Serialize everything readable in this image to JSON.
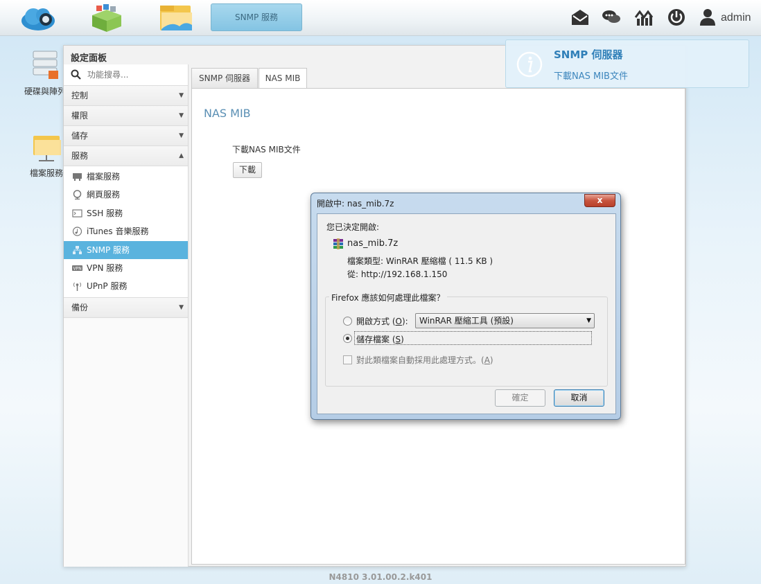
{
  "topbar": {
    "active_app": "SNMP 服務",
    "user": "admin",
    "icons": [
      "mail-icon",
      "chat-icon",
      "resource-monitor-icon",
      "power-icon",
      "user-icon"
    ]
  },
  "desktop": {
    "icons": [
      {
        "label": "硬碟與陣列"
      },
      {
        "label": "檔案服務"
      }
    ]
  },
  "window": {
    "title": "設定面板",
    "search_placeholder": "功能搜尋...",
    "sections": [
      {
        "label": "控制",
        "arrow": "▼"
      },
      {
        "label": "權限",
        "arrow": "▼"
      },
      {
        "label": "儲存",
        "arrow": "▼"
      },
      {
        "label": "服務",
        "arrow": "▲"
      },
      {
        "label": "備份",
        "arrow": "▼"
      }
    ],
    "service_items": [
      {
        "label": "檔案服務"
      },
      {
        "label": "網頁服務"
      },
      {
        "label": "SSH 服務"
      },
      {
        "label": "iTunes 音樂服務"
      },
      {
        "label": "SNMP 服務"
      },
      {
        "label": "VPN 服務"
      },
      {
        "label": "UPnP 服務"
      }
    ],
    "tabs": [
      {
        "label": "SNMP 伺服器"
      },
      {
        "label": "NAS MIB"
      }
    ],
    "panel_title": "NAS MIB",
    "download_desc": "下載NAS MIB文件",
    "download_button": "下載"
  },
  "notification": {
    "title": "SNMP 伺服器",
    "message": "下載NAS MIB文件"
  },
  "dialog": {
    "title": "開啟中: nas_mib.7z",
    "close": "x",
    "intro": "您已決定開啟:",
    "filename": "nas_mib.7z",
    "filetype": "檔案類型: WinRAR 壓縮檔 ( 11.5 KB )",
    "from": "從: http://192.168.1.150",
    "group_title": "Firefox 應該如何處理此檔案？",
    "open_with_label": "開啟方式 (",
    "open_with_key": "O",
    "open_with_suffix": "):",
    "open_with_value": "WinRAR 壓縮工具 (預設)",
    "save_label": "儲存檔案 (",
    "save_key": "S",
    "save_suffix": ")",
    "auto_label": "對此類檔案自動採用此處理方式。(",
    "auto_key": "A",
    "auto_suffix": ")",
    "ok": "確定",
    "cancel": "取消"
  },
  "footer": {
    "version": "N4810   3.01.00.2.k401"
  }
}
